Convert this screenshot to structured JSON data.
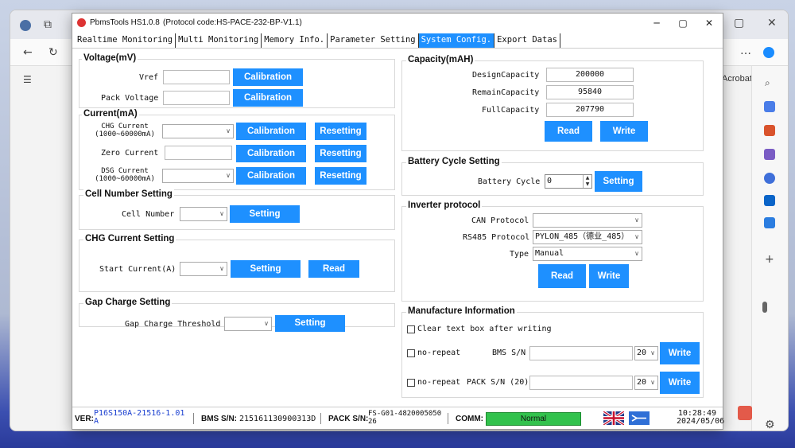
{
  "browser": {
    "side_label": "Acrobat",
    "icons": [
      "back-arrow-icon",
      "refresh-icon",
      "more-icon",
      "search-icon",
      "tag-icon",
      "toolbox-icon",
      "people-icon",
      "copilot-icon",
      "outlook-icon",
      "send-icon",
      "plus-icon",
      "settings-icon"
    ]
  },
  "app": {
    "title": "PbmsTools HS1.0.8",
    "protocol": "(Protocol code:HS-PACE-232-BP-V1.1)",
    "tabs": [
      "Realtime Monitoring",
      "Multi Monitoring",
      "Memory Info.",
      "Parameter Setting",
      "System Config.",
      "Export Datas"
    ],
    "active_tab": "System Config."
  },
  "voltage": {
    "title": "Voltage(mV)",
    "vref_label": "Vref",
    "vref_value": "",
    "pack_label": "Pack Voltage",
    "pack_value": "",
    "calibration": "Calibration"
  },
  "current": {
    "title": "Current(mA)",
    "chg_label_1": "CHG Current",
    "chg_label_2": "(1000~60000mA)",
    "zero_label": "Zero Current",
    "dsg_label_1": "DSG Current",
    "dsg_label_2": "(1000~60000mA)",
    "calibration": "Calibration",
    "resetting": "Resetting"
  },
  "cell_number": {
    "title": "Cell Number Setting",
    "label": "Cell Number",
    "setting": "Setting"
  },
  "chg_current": {
    "title": "CHG Current Setting",
    "label": "Start Current(A)",
    "setting": "Setting",
    "read": "Read"
  },
  "gap_charge": {
    "title": "Gap Charge Setting",
    "label": "Gap Charge Threshold",
    "setting": "Setting"
  },
  "capacity": {
    "title": "Capacity(mAH)",
    "design_label": "DesignCapacity",
    "design_value": "200000",
    "remain_label": "RemainCapacity",
    "remain_value": "95840",
    "full_label": "FullCapacity",
    "full_value": "207790",
    "read": "Read",
    "write": "Write"
  },
  "battery_cycle": {
    "title": "Battery Cycle Setting",
    "label": "Battery Cycle",
    "value": "0",
    "setting": "Setting"
  },
  "inverter": {
    "title": "Inverter protocol",
    "can_label": "CAN Protocol",
    "can_value": "",
    "rs485_label": "RS485 Protocol",
    "rs485_value": "PYLON_485（德业_485）",
    "type_label": "Type",
    "type_value": "Manual",
    "read": "Read",
    "write": "Write"
  },
  "manufacture": {
    "title": "Manufacture Information",
    "clear_label": "Clear text box after writing",
    "no_repeat": "no-repeat",
    "bms_label": "BMS S/N",
    "bms_value": "",
    "bms_len": "20",
    "pack_label": "PACK S/N (20)",
    "pack_value": "",
    "pack_len": "20",
    "write": "Write"
  },
  "status": {
    "ver_label": "VER:",
    "ver_value_1": "P16S150A-21516-1.01",
    "ver_value_2": "A",
    "bms_label": "BMS S/N:",
    "bms_value": "215161130900313D",
    "pack_label": "PACK S/N:",
    "pack_value_1": "FS-G01-4820005050",
    "pack_value_2": "26",
    "comm_label": "COMM:",
    "comm_value": "Normal",
    "time": "10:28:49",
    "date": "2024/05/06"
  }
}
